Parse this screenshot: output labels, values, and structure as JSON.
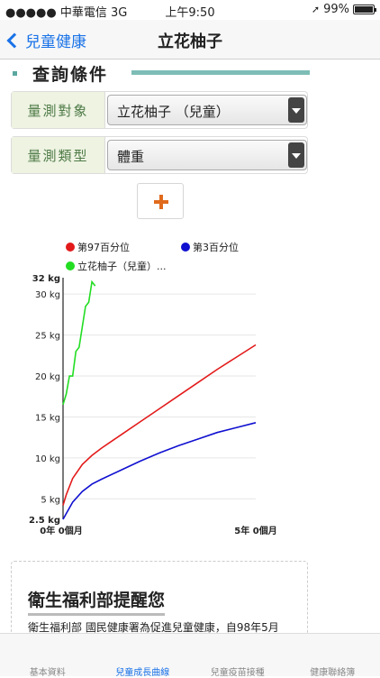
{
  "status": {
    "carrier": "●●●●● 中華電信  3G",
    "time": "上午9:50",
    "battery": "99%",
    "battery_level": 0.99
  },
  "nav": {
    "back_label": "兒童健康",
    "title": "立花柚子"
  },
  "query": {
    "heading": "查詢條件",
    "target_label": "量測對象",
    "target_value": "立花柚子 （兒童）",
    "type_label": "量測類型",
    "type_value": "體重"
  },
  "chart_data": {
    "type": "line",
    "x_ticks": [
      "0年 0個月",
      "5年 0個月"
    ],
    "y_ticks": [
      "2.5 kg",
      "5 kg",
      "10 kg",
      "15 kg",
      "20 kg",
      "25 kg",
      "30 kg",
      "32 kg"
    ],
    "ylim": [
      2.5,
      32
    ],
    "xlim_months": [
      0,
      60
    ],
    "series": [
      {
        "name": "第97百分位",
        "color": "#e31a1a",
        "x": [
          0,
          1,
          3,
          6,
          9,
          12,
          18,
          24,
          30,
          36,
          42,
          48,
          54,
          60
        ],
        "y": [
          4.2,
          5.5,
          7.5,
          9.2,
          10.3,
          11.2,
          12.8,
          14.4,
          16.0,
          17.6,
          19.2,
          20.8,
          22.3,
          23.8
        ]
      },
      {
        "name": "第3百分位",
        "color": "#1010d0",
        "x": [
          0,
          1,
          3,
          6,
          9,
          12,
          18,
          24,
          30,
          36,
          42,
          48,
          54,
          60
        ],
        "y": [
          2.5,
          3.2,
          4.6,
          5.9,
          6.8,
          7.4,
          8.5,
          9.6,
          10.6,
          11.5,
          12.3,
          13.1,
          13.7,
          14.3
        ]
      },
      {
        "name": "立花柚子（兒童）...",
        "color": "#22dd22",
        "x": [
          0,
          1,
          2,
          3,
          4,
          5,
          6,
          7,
          8,
          9,
          10
        ],
        "y": [
          16.5,
          17.8,
          20,
          20,
          23,
          23.5,
          26,
          28.5,
          29,
          31.5,
          31
        ]
      }
    ]
  },
  "reminder": {
    "heading": "衛生福利部提醒您",
    "text": "衛生福利部 國民健康署為促進兒童健康，自98年5月"
  },
  "tabs": [
    {
      "label": "基本資料",
      "active": false
    },
    {
      "label": "兒童成長曲線",
      "active": true
    },
    {
      "label": "兒童疫苗接種",
      "active": false
    },
    {
      "label": "健康聯絡簿",
      "active": false
    }
  ]
}
